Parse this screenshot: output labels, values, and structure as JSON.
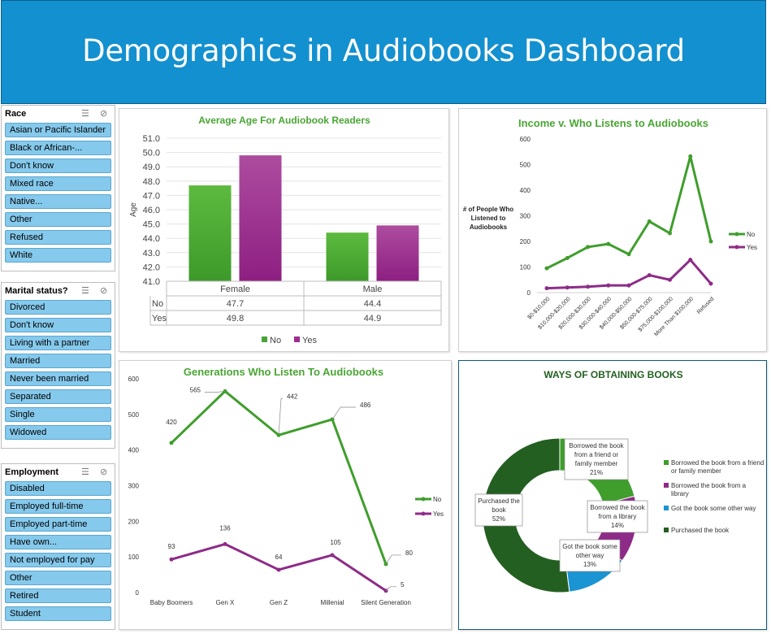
{
  "header": {
    "title": "Demographics in Audiobooks Dashboard",
    "bg": "#1390cf"
  },
  "slicers": {
    "race": {
      "title": "Race",
      "items": [
        "Asian or Pacific Islander",
        "Black or African-...",
        "Don't know",
        "Mixed race",
        "Native...",
        "Other",
        "Refused",
        "White"
      ]
    },
    "marital": {
      "title": "Marital status?",
      "items": [
        "Divorced",
        "Don't know",
        "Living with a partner",
        "Married",
        "Never been married",
        "Separated",
        "Single",
        "Widowed"
      ]
    },
    "employment": {
      "title": "Employment",
      "items": [
        "Disabled",
        "Employed full-time",
        "Employed part-time",
        "Have own...",
        "Not employed for pay",
        "Other",
        "Retired",
        "Student"
      ]
    }
  },
  "chart_data": [
    {
      "type": "bar",
      "title": "Average Age For Audiobook Readers",
      "ylabel": "Age",
      "categories": [
        "Female",
        "Male"
      ],
      "series": [
        {
          "name": "No",
          "values": [
            47.7,
            44.4
          ],
          "color": "#4aa534"
        },
        {
          "name": "Yes",
          "values": [
            49.8,
            44.9
          ],
          "color": "#9e2d8f"
        }
      ],
      "ylim": [
        41.0,
        51.0
      ],
      "yticks": [
        "51.0",
        "50.0",
        "49.0",
        "48.0",
        "47.0",
        "46.0",
        "45.0",
        "44.0",
        "43.0",
        "42.0",
        "41.0"
      ],
      "table": {
        "rows": [
          {
            "label": "No",
            "cells": [
              "47.7",
              "44.4"
            ]
          },
          {
            "label": "Yes",
            "cells": [
              "49.8",
              "44.9"
            ]
          }
        ]
      },
      "legend": [
        "No",
        "Yes"
      ],
      "legend_position": "bottom"
    },
    {
      "type": "line",
      "title": "Income v. Who Listens to Audiobooks",
      "ylabel": "# of People Who Listened to Audiobooks",
      "categories": [
        "$0-$10,000",
        "$10,000-$20,000",
        "$20,000-$30,000",
        "$30,000-$40,000",
        "$40,000-$50,000",
        "$50,000-$75,000",
        "$75,000-$100,000",
        "More Than $100,000",
        "Refused"
      ],
      "series": [
        {
          "name": "No",
          "values": [
            95,
            135,
            178,
            190,
            150,
            278,
            232,
            532,
            200
          ],
          "color": "#3f9e2c"
        },
        {
          "name": "Yes",
          "values": [
            17,
            20,
            23,
            28,
            28,
            68,
            50,
            128,
            35
          ],
          "color": "#8e2b88"
        }
      ],
      "ylim": [
        0,
        600
      ],
      "yticks": [
        "0",
        "100",
        "200",
        "300",
        "400",
        "500",
        "600"
      ],
      "legend": [
        "No",
        "Yes"
      ],
      "legend_position": "right"
    },
    {
      "type": "line",
      "title": "Generations Who Listen To Audiobooks",
      "categories": [
        "Baby Boomers",
        "Gen X",
        "Gen Z",
        "Millenial",
        "Silent Generation"
      ],
      "series": [
        {
          "name": "No",
          "values": [
            420,
            565,
            442,
            486,
            80
          ],
          "labels": [
            "420",
            "565",
            "442",
            "486",
            "80"
          ],
          "color": "#3f9e2c"
        },
        {
          "name": "Yes",
          "values": [
            93,
            136,
            64,
            105,
            5
          ],
          "labels": [
            "93",
            "136",
            "64",
            "105",
            "5"
          ],
          "color": "#8e2b88"
        }
      ],
      "ylim": [
        0,
        600
      ],
      "yticks": [
        "0",
        "100",
        "200",
        "300",
        "400",
        "500",
        "600"
      ],
      "legend": [
        "No",
        "Yes"
      ],
      "legend_position": "right"
    },
    {
      "type": "pie",
      "donut": true,
      "title": "WAYS OF OBTAINING BOOKS",
      "slices": [
        {
          "name": "Borrowed the book from a friend or family member",
          "value": 21,
          "label": "Borrowed the book from a friend or family member",
          "pct": "21%",
          "color": "#3f9e2c"
        },
        {
          "name": "Borrowed the book from a library",
          "value": 14,
          "label": "Borrowed the book from a library",
          "pct": "14%",
          "color": "#8e2b88"
        },
        {
          "name": "Got the book some other way",
          "value": 13,
          "label": "Got the book some other way",
          "pct": "13%",
          "color": "#1a94d2"
        },
        {
          "name": "Purchased the book",
          "value": 52,
          "label": "Purchased the book",
          "pct": "52%",
          "color": "#245f22"
        }
      ],
      "legend_position": "right"
    }
  ]
}
